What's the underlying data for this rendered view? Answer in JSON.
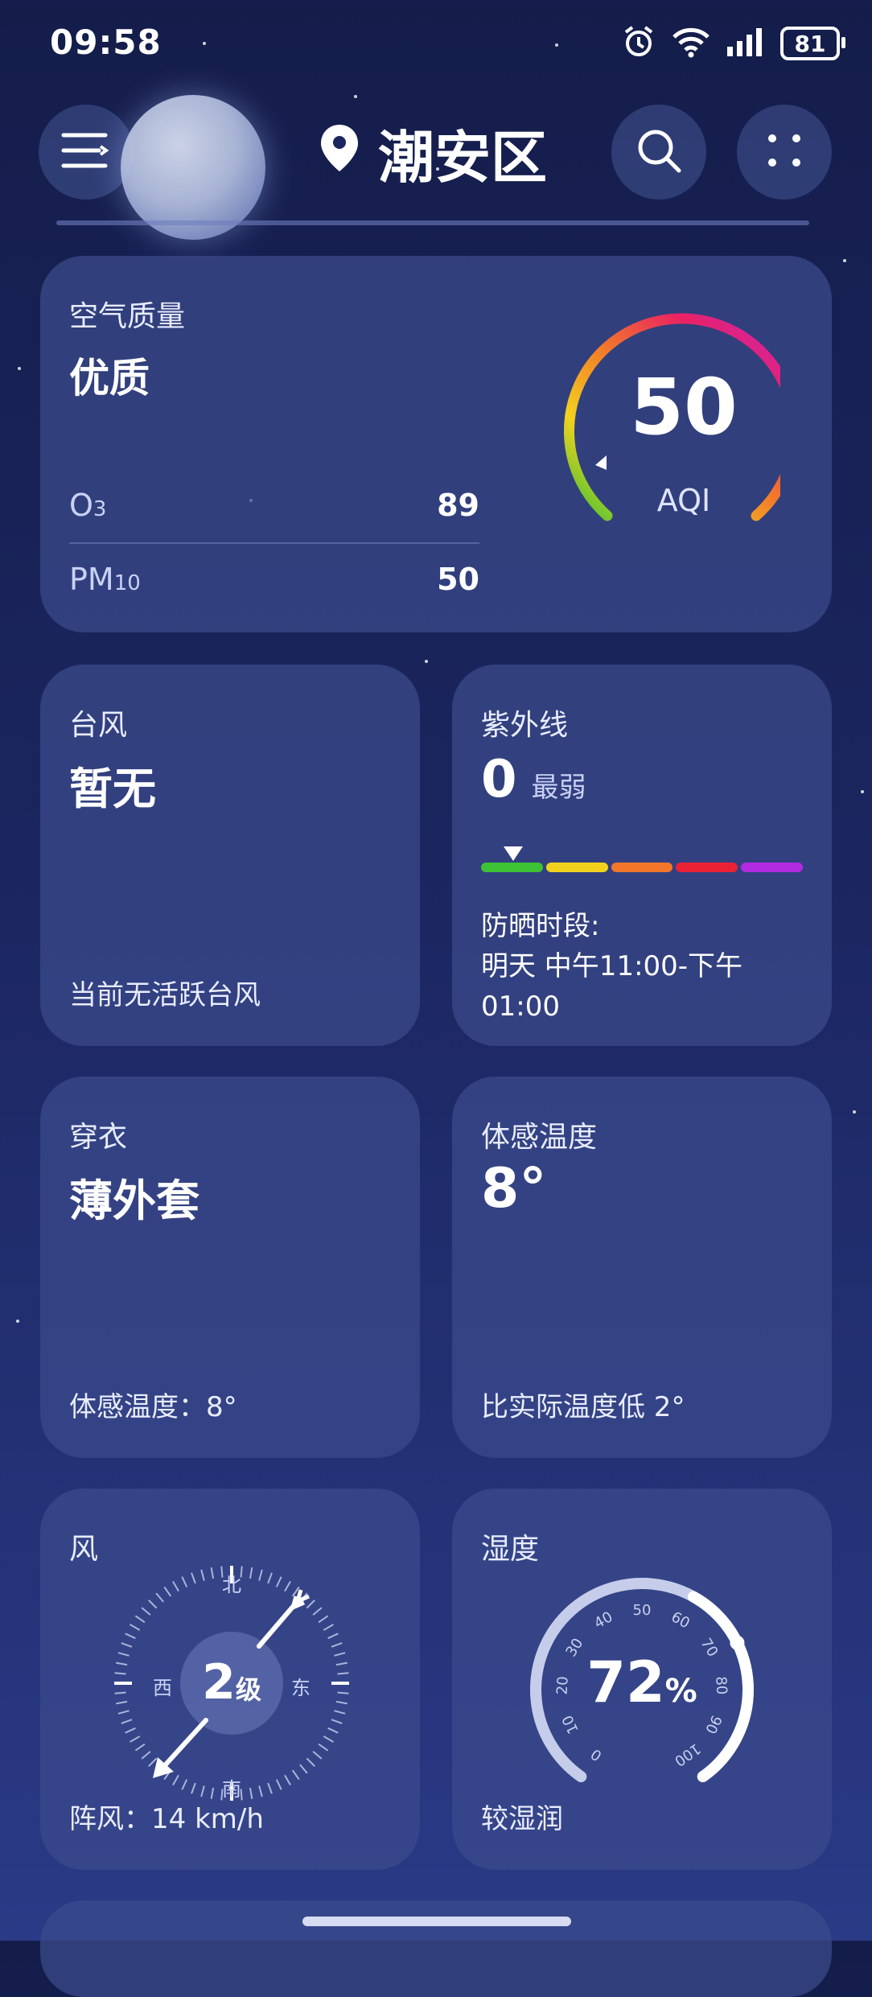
{
  "status_bar": {
    "time": "09:58",
    "battery": "81"
  },
  "header": {
    "location": "潮安区"
  },
  "air_quality": {
    "label": "空气质量",
    "level": "优质",
    "aqi": "50",
    "aqi_unit": "AQI",
    "pollutants": [
      {
        "name": "O",
        "sub": "3",
        "value": "89"
      },
      {
        "name": "PM",
        "sub": "10",
        "value": "50"
      }
    ]
  },
  "typhoon": {
    "label": "台风",
    "value": "暂无",
    "footer": "当前无活跃台风"
  },
  "uv": {
    "label": "紫外线",
    "value": "0",
    "desc": "最弱",
    "level_fraction": 0.1,
    "scale_colors": [
      "#3cc234",
      "#f3d21e",
      "#f2762a",
      "#ea2235",
      "#b12be0"
    ],
    "sun_title": "防晒时段:",
    "sun_time_line1": "明天 中午11:00-下午",
    "sun_time_line2": "01:00"
  },
  "clothing": {
    "label": "穿衣",
    "value": "薄外套",
    "footer": "体感温度：8°"
  },
  "feels_like": {
    "label": "体感温度",
    "value": "8°",
    "footer": "比实际温度低 2°"
  },
  "wind": {
    "label": "风",
    "level": "2",
    "level_unit": "级",
    "north": "北",
    "south": "南",
    "east": "东",
    "west": "西",
    "footer": "阵风：14 km/h"
  },
  "humidity": {
    "label": "湿度",
    "value": "72",
    "unit": "%",
    "fraction": 0.72,
    "ticks": [
      "0",
      "10",
      "20",
      "30",
      "40",
      "50",
      "60",
      "70",
      "80",
      "90",
      "100"
    ],
    "footer": "较湿润"
  }
}
